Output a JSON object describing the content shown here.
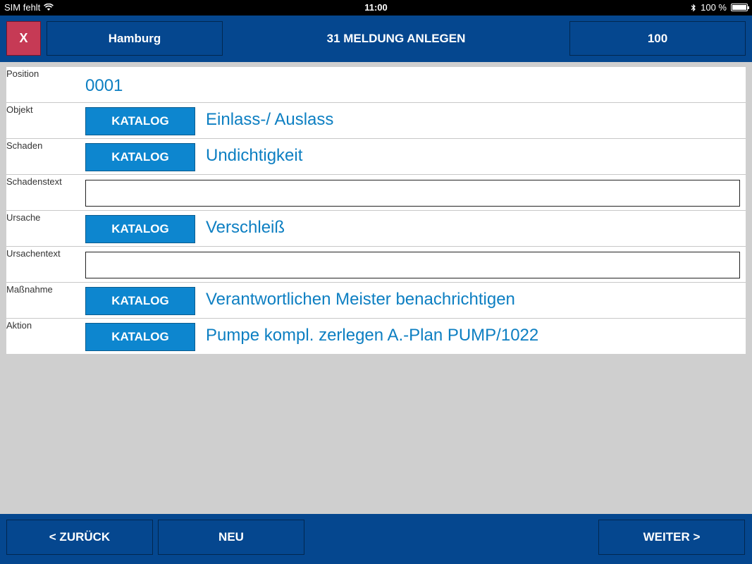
{
  "status": {
    "carrier": "SIM fehlt",
    "time": "11:00",
    "battery": "100 %"
  },
  "header": {
    "close_label": "X",
    "location": "Hamburg",
    "title": "31 MELDUNG ANLEGEN",
    "number": "100"
  },
  "form": {
    "rows": [
      {
        "label": "Position",
        "value": "0001"
      },
      {
        "label": "Objekt",
        "button": "KATALOG",
        "value": "Einlass-/ Auslass"
      },
      {
        "label": "Schaden",
        "button": "KATALOG",
        "value": "Undichtigkeit"
      },
      {
        "label": "Schadenstext",
        "value": ""
      },
      {
        "label": "Ursache",
        "button": "KATALOG",
        "value": "Verschleiß"
      },
      {
        "label": "Ursachentext",
        "value": ""
      },
      {
        "label": "Maßnahme",
        "button": "KATALOG",
        "value": "Verantwortlichen Meister benachrichtigen"
      },
      {
        "label": "Aktion",
        "button": "KATALOG",
        "value": "Pumpe kompl. zerlegen A.-Plan PUMP/1022"
      }
    ]
  },
  "footer": {
    "back_label": "< ZURÜCK",
    "new_label": "NEU",
    "next_label": "WEITER >"
  }
}
